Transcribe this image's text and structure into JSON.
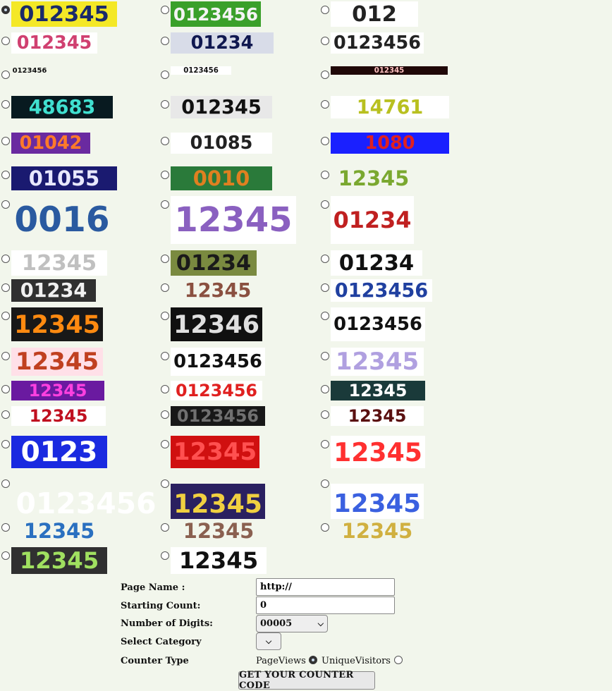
{
  "styles": [
    {
      "digits": "012345",
      "bg": "#f4e826",
      "fg": "#1a2a6a",
      "selected": true
    },
    {
      "digits": "0123456",
      "bg": "#3aa02a",
      "fg": "#f4f4f4",
      "selected": false
    },
    {
      "digits": "012",
      "bg": "#ffffff",
      "fg": "#222222",
      "selected": false
    },
    {
      "digits": "012345",
      "bg": "#ffffff",
      "fg": "#d04070",
      "selected": false
    },
    {
      "digits": "01234",
      "bg": "#d8dce8",
      "fg": "#101850",
      "selected": false
    },
    {
      "digits": "0123456",
      "bg": "#ffffff",
      "fg": "#222222",
      "selected": false
    },
    {
      "digits": "0123456",
      "bg": "#f2f6ec",
      "fg": "#111111",
      "selected": false
    },
    {
      "digits": "0123456",
      "bg": "#ffffff",
      "fg": "#111111",
      "selected": false
    },
    {
      "digits": "012345",
      "bg": "#200808",
      "fg": "#ffc0c0",
      "selected": false
    },
    {
      "digits": "48683",
      "bg": "#081a20",
      "fg": "#40e0d0",
      "selected": false
    },
    {
      "digits": "012345",
      "bg": "#e8e8e8",
      "fg": "#111111",
      "selected": false
    },
    {
      "digits": "14761",
      "bg": "#ffffff",
      "fg": "#b8c020",
      "selected": false
    },
    {
      "digits": "01042",
      "bg": "#6a2aa0",
      "fg": "#ff7a2a",
      "selected": false
    },
    {
      "digits": "01085",
      "bg": "#ffffff",
      "fg": "#222222",
      "selected": false
    },
    {
      "digits": "1080",
      "bg": "#1a20ff",
      "fg": "#e02020",
      "selected": false
    },
    {
      "digits": "01055",
      "bg": "#1a1a70",
      "fg": "#e8e8ff",
      "selected": false
    },
    {
      "digits": "0010",
      "bg": "#2a7a3a",
      "fg": "#e08020",
      "selected": false
    },
    {
      "digits": "12345",
      "bg": "#f2f6ec",
      "fg": "#7aa830",
      "selected": false
    },
    {
      "digits": "0016",
      "bg": "#f2f6ec",
      "fg": "#2a5aa0",
      "selected": false
    },
    {
      "digits": "12345",
      "bg": "#ffffff",
      "fg": "#8a60c0",
      "selected": false
    },
    {
      "digits": "01234",
      "bg": "#ffffff",
      "fg": "#c02020",
      "selected": false
    },
    {
      "digits": "12345",
      "bg": "#ffffff",
      "fg": "#c0c0c0",
      "selected": false
    },
    {
      "digits": "01234",
      "bg": "#7a8a40",
      "fg": "#1a1a1a",
      "selected": false
    },
    {
      "digits": "01234",
      "bg": "#ffffff",
      "fg": "#111111",
      "selected": false
    },
    {
      "digits": "01234",
      "bg": "#303030",
      "fg": "#f0f0f0",
      "selected": false
    },
    {
      "digits": "12345",
      "bg": "#f2f6ec",
      "fg": "#8a5040",
      "selected": false
    },
    {
      "digits": "0123456",
      "bg": "#ffffff",
      "fg": "#2040a0",
      "selected": false
    },
    {
      "digits": "12345",
      "bg": "#181818",
      "fg": "#ff8a10",
      "selected": false
    },
    {
      "digits": "12346",
      "bg": "#101010",
      "fg": "#e0e0e0",
      "selected": false
    },
    {
      "digits": "0123456",
      "bg": "#ffffff",
      "fg": "#111111",
      "selected": false
    },
    {
      "digits": "12345",
      "bg": "#ffe0e8",
      "fg": "#c04020",
      "selected": false
    },
    {
      "digits": "0123456",
      "bg": "#ffffff",
      "fg": "#111111",
      "selected": false
    },
    {
      "digits": "12345",
      "bg": "#ffffff",
      "fg": "#b0a0e0",
      "selected": false
    },
    {
      "digits": "12345",
      "bg": "#6a1aa0",
      "fg": "#ff40e0",
      "selected": false
    },
    {
      "digits": "0123456",
      "bg": "#ffffff",
      "fg": "#e02020",
      "selected": false
    },
    {
      "digits": "12345",
      "bg": "#1a3a3a",
      "fg": "#ffffff",
      "selected": false
    },
    {
      "digits": "12345",
      "bg": "#ffffff",
      "fg": "#c01020",
      "selected": false
    },
    {
      "digits": "0123456",
      "bg": "#181818",
      "fg": "#707070",
      "selected": false
    },
    {
      "digits": "12345",
      "bg": "#ffffff",
      "fg": "#5a1010",
      "selected": false
    },
    {
      "digits": "0123",
      "bg": "#1a2ae0",
      "fg": "#ffffff",
      "selected": false
    },
    {
      "digits": "12345",
      "bg": "#d01010",
      "fg": "#ff5050",
      "selected": false
    },
    {
      "digits": "12345",
      "bg": "#ffffff",
      "fg": "#ff3030",
      "selected": false
    },
    {
      "digits": "0123456",
      "bg": "#f2f6ec",
      "fg": "#ffffff",
      "selected": false
    },
    {
      "digits": "12345",
      "bg": "#2a2060",
      "fg": "#f0d040",
      "selected": false
    },
    {
      "digits": "12345",
      "bg": "#ffffff",
      "fg": "#3a60e0",
      "selected": false
    },
    {
      "digits": "12345",
      "bg": "#f2f6ec",
      "fg": "#2a70c0",
      "selected": false
    },
    {
      "digits": "12345",
      "bg": "#f2f6ec",
      "fg": "#8a6050",
      "selected": false
    },
    {
      "digits": "12345",
      "bg": "#f2f6ec",
      "fg": "#d0b040",
      "selected": false
    },
    {
      "digits": "12345",
      "bg": "#303030",
      "fg": "#a0e060",
      "selected": false
    },
    {
      "digits": "12345",
      "bg": "#ffffff",
      "fg": "#111111",
      "selected": false
    }
  ],
  "form": {
    "page_name_label": "Page Name :",
    "page_name_value": "http://",
    "starting_count_label": "Starting Count:",
    "starting_count_value": "0",
    "digits_label": "Number of Digits:",
    "digits_value": "00005",
    "category_label": "Select Category",
    "category_value": "",
    "counter_type_label": "Counter Type",
    "pageviews_label": "PageViews",
    "unique_label": "UniqueVisitors",
    "submit_label": "GET YOUR COUNTER CODE"
  }
}
